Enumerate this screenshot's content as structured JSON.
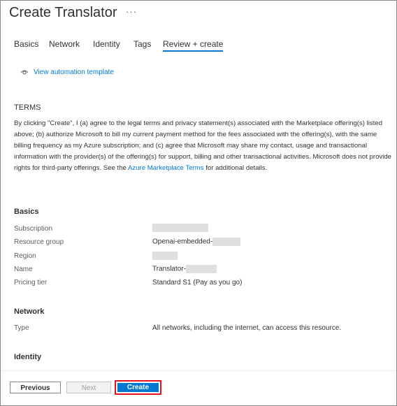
{
  "header": {
    "title": "Create Translator",
    "more": "···"
  },
  "tabs": [
    {
      "label": "Basics"
    },
    {
      "label": "Network"
    },
    {
      "label": "Identity"
    },
    {
      "label": "Tags"
    },
    {
      "label": "Review + create"
    }
  ],
  "active_tab": "Review + create",
  "automation": {
    "link": "View automation template",
    "icon": "eye-icon"
  },
  "terms": {
    "heading": "TERMS",
    "text_before": "By clicking \"Create\", I (a) agree to the legal terms and privacy statement(s) associated with the Marketplace offering(s) listed above; (b) authorize Microsoft to bill my current payment method for the fees associated with the offering(s), with the same billing frequency as my Azure subscription; and (c) agree that Microsoft may share my contact, usage and transactional information with the provider(s) of the offering(s) for support, billing and other transactional activities. Microsoft does not provide rights for third-party offerings. See the ",
    "link": "Azure Marketplace Terms",
    "text_after": " for additional details."
  },
  "basics": {
    "heading": "Basics",
    "subscription_label": "Subscription",
    "resource_group_label": "Resource group",
    "resource_group_value": "Openai-embedded-",
    "region_label": "Region",
    "name_label": "Name",
    "name_value": "Translator-",
    "pricing_label": "Pricing tier",
    "pricing_value": "Standard S1 (Pay as you go)"
  },
  "network": {
    "heading": "Network",
    "type_label": "Type",
    "type_value": "All networks, including the internet, can access this resource."
  },
  "identity": {
    "heading": "Identity"
  },
  "footer": {
    "previous": "Previous",
    "next": "Next",
    "create": "Create"
  },
  "colors": {
    "accent": "#0078d4",
    "highlight": "#e81123"
  }
}
